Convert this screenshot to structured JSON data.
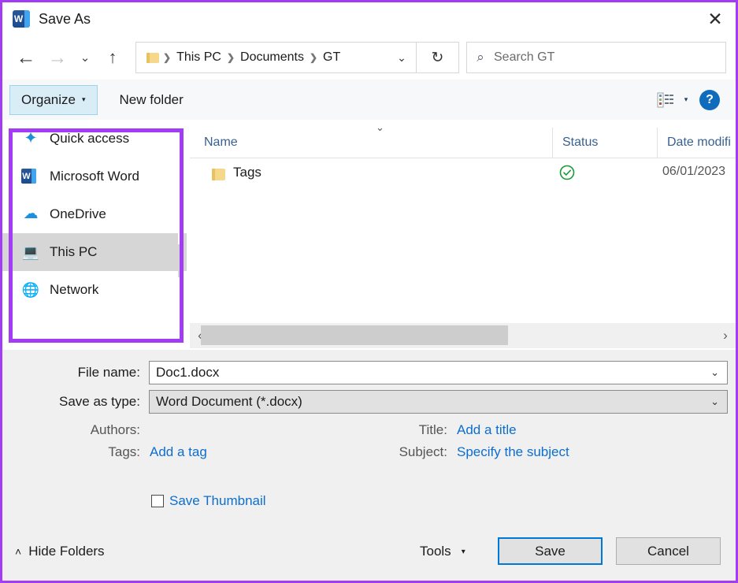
{
  "window": {
    "title": "Save As",
    "app_icon": "word-icon",
    "close_label": "✕"
  },
  "navbar": {
    "back_icon": "←",
    "forward_icon": "→",
    "recent_icon": "⌄",
    "up_icon": "↑",
    "breadcrumbs": [
      "This PC",
      "Documents",
      "GT"
    ],
    "separator": "❯",
    "dropdown_icon": "⌄",
    "refresh_icon": "↻",
    "search": {
      "placeholder": "Search GT",
      "icon": "⌕"
    }
  },
  "commandbar": {
    "organize_label": "Organize",
    "organize_caret": "▾",
    "new_folder_label": "New folder",
    "view_caret": "▾",
    "help_label": "?"
  },
  "nav_pane": {
    "items": [
      {
        "label": "Quick access",
        "icon": "star-icon",
        "glyph": "★",
        "selected": false
      },
      {
        "label": "Microsoft Word",
        "icon": "word-icon",
        "glyph": "W",
        "selected": false
      },
      {
        "label": "OneDrive",
        "icon": "cloud-icon",
        "glyph": "☁",
        "selected": false
      },
      {
        "label": "This PC",
        "icon": "computer-icon",
        "glyph": "⎙",
        "selected": true
      },
      {
        "label": "Network",
        "icon": "network-icon",
        "glyph": "☸",
        "selected": false
      }
    ],
    "highlight_color": "#a33df5"
  },
  "file_list": {
    "sort_chevron": "⌄",
    "columns": [
      "Name",
      "Status",
      "Date modifi"
    ],
    "rows": [
      {
        "name": "Tags",
        "status": "available-offline",
        "date": "06/01/2023"
      }
    ],
    "scroll_left_icon": "‹",
    "scroll_right_icon": "›"
  },
  "form": {
    "file_name_label": "File name:",
    "file_name_value": "Doc1.docx",
    "save_as_type_label": "Save as type:",
    "save_as_type_value": "Word Document (*.docx)",
    "combo_caret": "⌄",
    "authors_label": "Authors:",
    "authors_value": "",
    "tags_label": "Tags:",
    "tags_link": "Add a tag",
    "title_label": "Title:",
    "title_link": "Add a title",
    "subject_label": "Subject:",
    "subject_link": "Specify the subject",
    "save_thumbnail_label": "Save Thumbnail",
    "save_thumbnail_checked": false
  },
  "footer": {
    "hide_folders_label": "Hide Folders",
    "hide_folders_caret": "˄",
    "tools_label": "Tools",
    "tools_caret": "▾",
    "save_label": "Save",
    "cancel_label": "Cancel",
    "save_focus_color": "#0078d7"
  }
}
